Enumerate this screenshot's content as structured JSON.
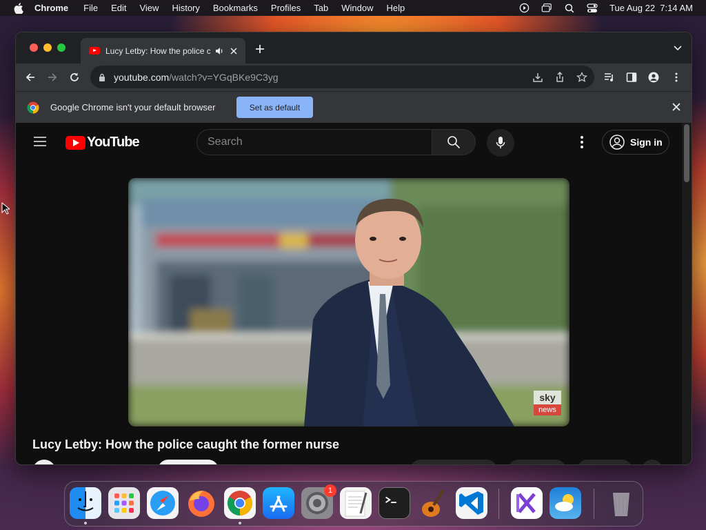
{
  "menubar": {
    "app": "Chrome",
    "items": [
      "File",
      "Edit",
      "View",
      "History",
      "Bookmarks",
      "Profiles",
      "Tab",
      "Window",
      "Help"
    ],
    "clock": "Tue Aug 22  7:14 AM",
    "status_icons": [
      "play-circle-icon",
      "screen-mirror-icon",
      "spotlight-search-icon",
      "control-center-icon"
    ]
  },
  "browser": {
    "tab_title": "Lucy Letby: How the police caught the former nurse",
    "url_host": "youtube.com",
    "url_path": "/watch?v=YGqBKe9C3yg",
    "infobar_text": "Google Chrome isn't your default browser",
    "infobar_button": "Set as default"
  },
  "youtube": {
    "logo_text": "YouTube",
    "search_placeholder": "Search",
    "signin_label": "Sign in",
    "video_title": "Lucy Letby: How the police caught the former nurse",
    "watermark_top": "sky",
    "watermark_bottom": "news"
  },
  "dock": {
    "apps": [
      {
        "name": "Finder",
        "color": "#1e8cf0",
        "running": true
      },
      {
        "name": "Launchpad",
        "color": "#e6e6ea",
        "running": false
      },
      {
        "name": "Safari",
        "color": "#2a9df4",
        "running": false
      },
      {
        "name": "Firefox",
        "color": "#ff7139",
        "running": false
      },
      {
        "name": "Chrome",
        "color": "#ffffff",
        "running": true
      },
      {
        "name": "App Store",
        "color": "#1a8cff",
        "running": false
      },
      {
        "name": "System Settings",
        "color": "#8a8a8e",
        "running": false,
        "badge": "1"
      },
      {
        "name": "TextEdit",
        "color": "#f4f4f4",
        "running": false
      },
      {
        "name": "Terminal",
        "color": "#1e1e1e",
        "running": false
      },
      {
        "name": "GarageBand",
        "color": "#f08a24",
        "running": false
      },
      {
        "name": "Visual Studio Code",
        "color": "#0078d4",
        "running": false
      },
      {
        "name": "Visual Studio",
        "color": "#ffffff",
        "running": false
      },
      {
        "name": "Weather",
        "color": "#1e7fd8",
        "running": false
      },
      {
        "name": "Trash",
        "color": "#bfbfc4",
        "running": false
      }
    ]
  },
  "colors": {
    "chrome_dark": "#202124",
    "chrome_toolbar": "#35363a",
    "button_blue": "#8ab4f8",
    "youtube_red": "#ff0000",
    "youtube_bg": "#0f0f0f"
  }
}
